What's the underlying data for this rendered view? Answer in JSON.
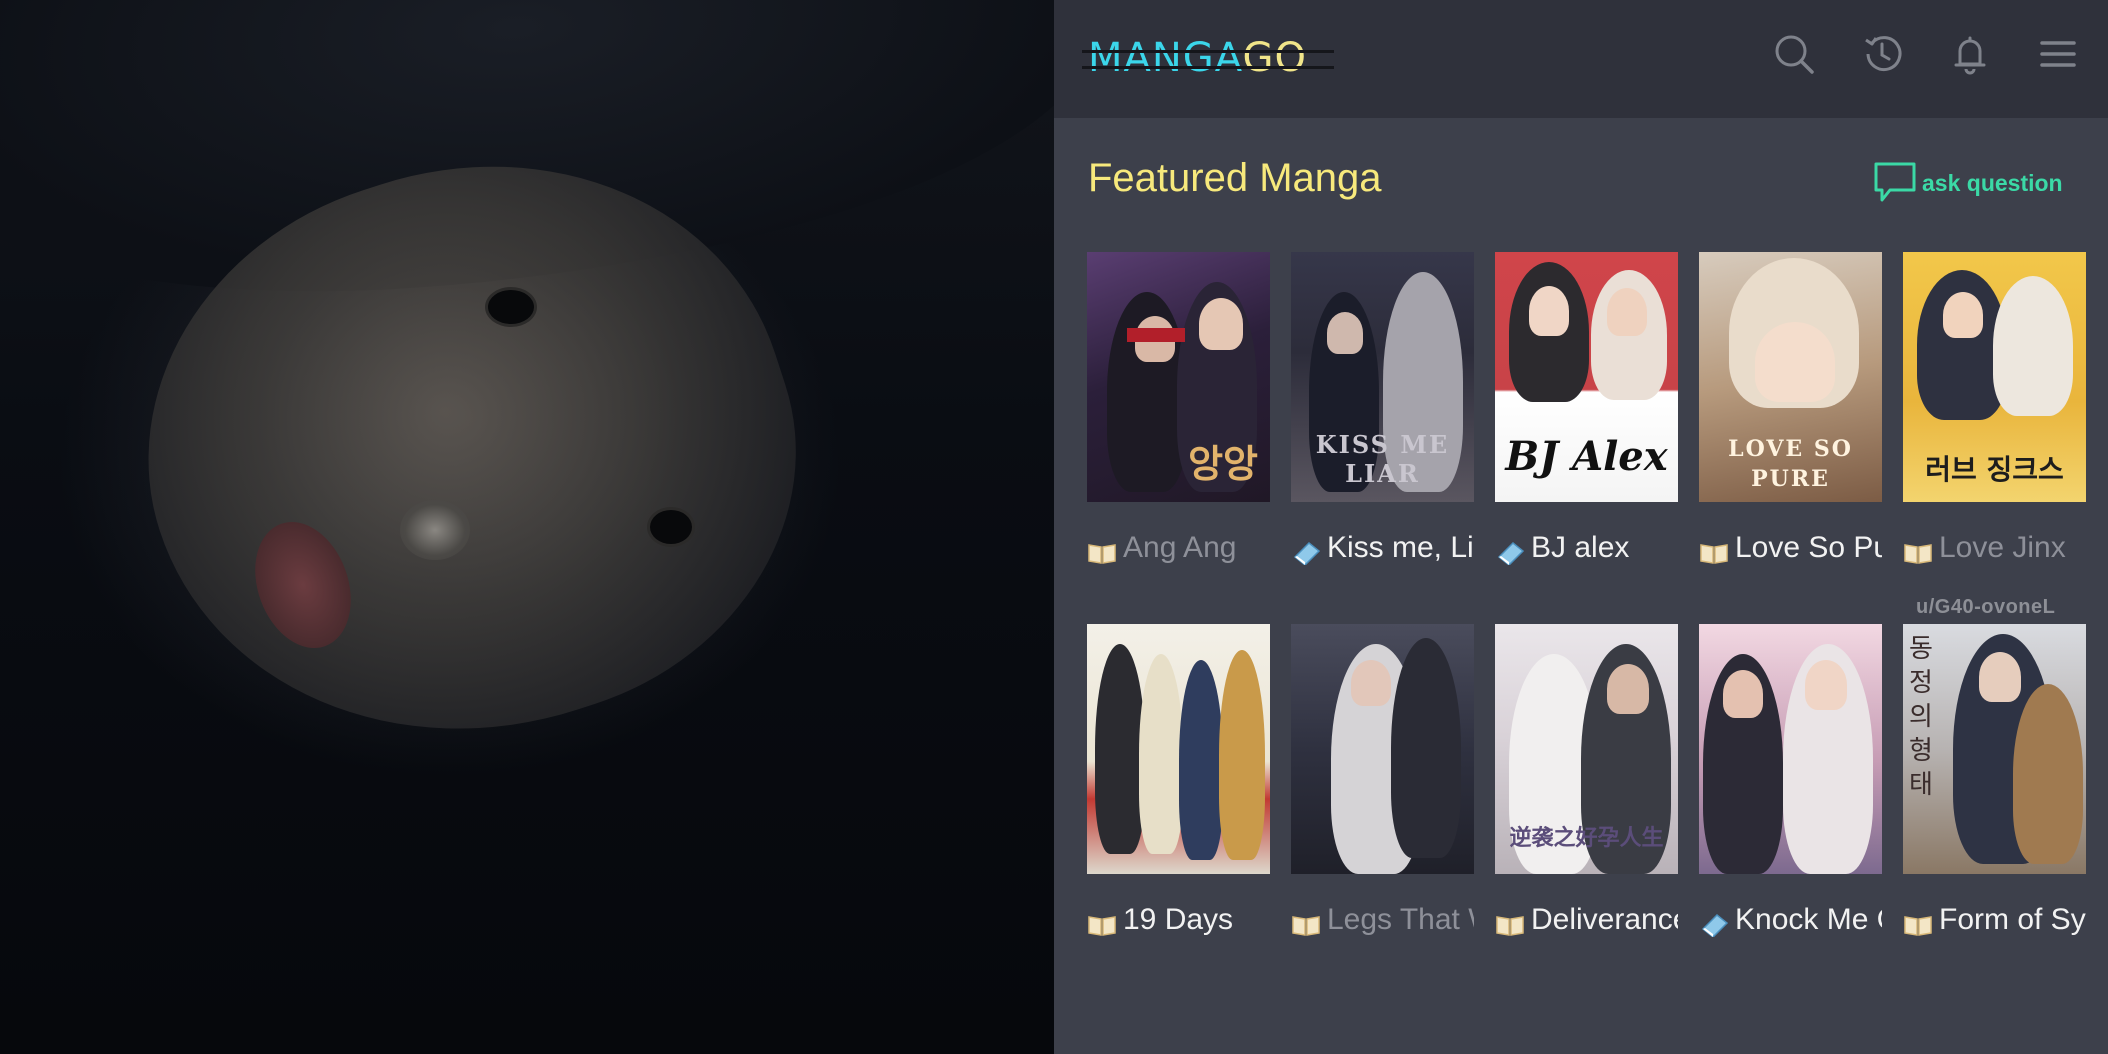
{
  "app": {
    "logo_part1": "MANGA",
    "logo_part2": "GO",
    "section_title": "Featured Manga",
    "ask_label": "ask question",
    "watermark": "u/G40-ovoneL"
  },
  "icons": {
    "search": "search-icon",
    "history": "history-icon",
    "notifications": "bell-icon",
    "menu": "menu-icon",
    "ask": "speech-bubble-icon",
    "book_open": "open-book-icon",
    "book_closed": "closed-book-icon"
  },
  "colors": {
    "accent_yellow": "#f7e97c",
    "accent_teal": "#3bd9a6",
    "logo_cyan": "#3bd6ea",
    "topbar": "#2f313b",
    "background": "#3d404b"
  },
  "featured": [
    {
      "title": "Ang Ang",
      "cover_text": "앙앙",
      "book_icon": "open-book-icon",
      "read": true
    },
    {
      "title": "Kiss me, Liar",
      "cover_text": "KISS ME LIAR",
      "book_icon": "closed-book-icon",
      "read": false
    },
    {
      "title": "BJ alex",
      "cover_text": "BJ Alex",
      "book_icon": "closed-book-icon",
      "read": false
    },
    {
      "title": "Love So Pure",
      "cover_text": "LOVE SO PURE",
      "book_icon": "open-book-icon",
      "read": false
    },
    {
      "title": "Love Jinx",
      "cover_text": "러브 징크스",
      "book_icon": "open-book-icon",
      "read": true
    },
    {
      "title": "19 Days",
      "cover_text": "",
      "book_icon": "open-book-icon",
      "read": false
    },
    {
      "title": "Legs That Won't Walk",
      "cover_text": "",
      "book_icon": "open-book-icon",
      "read": true
    },
    {
      "title": "Deliverance",
      "cover_text": "逆袭之好孕人生",
      "book_icon": "open-book-icon",
      "read": false
    },
    {
      "title": "Knock Me Out",
      "cover_text": "",
      "book_icon": "closed-book-icon",
      "read": false
    },
    {
      "title": "Form of Sympathy",
      "cover_text": "동정의 형태",
      "book_icon": "open-book-icon",
      "read": false
    }
  ]
}
